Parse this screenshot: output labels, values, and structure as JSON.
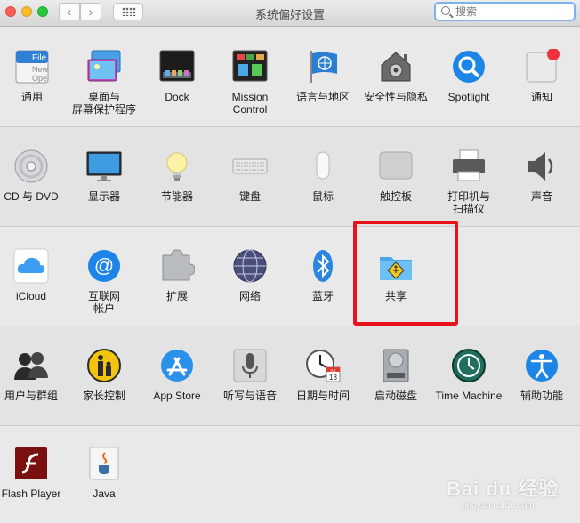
{
  "window": {
    "title": "系统偏好设置"
  },
  "nav": {
    "back_glyph": "‹",
    "forward_glyph": "›"
  },
  "search": {
    "placeholder": "搜索"
  },
  "sections": [
    {
      "items": [
        {
          "id": "general",
          "label": "通用",
          "icon": "general-icon"
        },
        {
          "id": "desktop",
          "label": "桌面与\n屏幕保护程序",
          "icon": "desktop-screensaver-icon"
        },
        {
          "id": "dock",
          "label": "Dock",
          "icon": "dock-icon"
        },
        {
          "id": "mission",
          "label": "Mission\nControl",
          "icon": "mission-control-icon"
        },
        {
          "id": "language",
          "label": "语言与地区",
          "icon": "language-region-icon"
        },
        {
          "id": "security",
          "label": "安全性与隐私",
          "icon": "security-privacy-icon"
        },
        {
          "id": "spotlight",
          "label": "Spotlight",
          "icon": "spotlight-icon"
        },
        {
          "id": "notifications",
          "label": "通知",
          "icon": "notifications-icon"
        }
      ]
    },
    {
      "items": [
        {
          "id": "cddvd",
          "label": "CD 与 DVD",
          "icon": "cd-dvd-icon"
        },
        {
          "id": "displays",
          "label": "显示器",
          "icon": "displays-icon"
        },
        {
          "id": "energy",
          "label": "节能器",
          "icon": "energy-saver-icon"
        },
        {
          "id": "keyboard",
          "label": "键盘",
          "icon": "keyboard-icon"
        },
        {
          "id": "mouse",
          "label": "鼠标",
          "icon": "mouse-icon"
        },
        {
          "id": "trackpad",
          "label": "触控板",
          "icon": "trackpad-icon"
        },
        {
          "id": "printers",
          "label": "打印机与\n扫描仪",
          "icon": "printer-scanner-icon"
        },
        {
          "id": "sound",
          "label": "声音",
          "icon": "sound-icon"
        }
      ]
    },
    {
      "items": [
        {
          "id": "icloud",
          "label": "iCloud",
          "icon": "icloud-icon"
        },
        {
          "id": "internet",
          "label": "互联网\n帐户",
          "icon": "internet-accounts-icon"
        },
        {
          "id": "extensions",
          "label": "扩展",
          "icon": "extensions-icon"
        },
        {
          "id": "network",
          "label": "网络",
          "icon": "network-icon"
        },
        {
          "id": "bluetooth",
          "label": "蓝牙",
          "icon": "bluetooth-icon"
        },
        {
          "id": "sharing",
          "label": "共享",
          "icon": "sharing-icon"
        }
      ]
    },
    {
      "items": [
        {
          "id": "users",
          "label": "用户与群组",
          "icon": "users-groups-icon"
        },
        {
          "id": "parental",
          "label": "家长控制",
          "icon": "parental-controls-icon"
        },
        {
          "id": "appstore",
          "label": "App Store",
          "icon": "app-store-icon"
        },
        {
          "id": "dictation",
          "label": "听写与语音",
          "icon": "dictation-speech-icon"
        },
        {
          "id": "datetime",
          "label": "日期与时间",
          "icon": "date-time-icon"
        },
        {
          "id": "startup",
          "label": "启动磁盘",
          "icon": "startup-disk-icon"
        },
        {
          "id": "timemachine",
          "label": "Time Machine",
          "icon": "time-machine-icon"
        },
        {
          "id": "accessibility",
          "label": "辅助功能",
          "icon": "accessibility-icon"
        }
      ]
    },
    {
      "items": [
        {
          "id": "flash",
          "label": "Flash Player",
          "icon": "flash-player-icon"
        },
        {
          "id": "java",
          "label": "Java",
          "icon": "java-icon"
        }
      ]
    }
  ],
  "icon_text": {
    "general_file": "File",
    "general_new": "New",
    "general_open": "Ope",
    "calendar_month": "JUL",
    "calendar_day": "18"
  },
  "watermark": {
    "brand": "Bai du 经验",
    "url": "jingyan.baidu.com"
  },
  "colors": {
    "highlight": "#e8121c",
    "accent_blue": "#1d7ff0"
  }
}
